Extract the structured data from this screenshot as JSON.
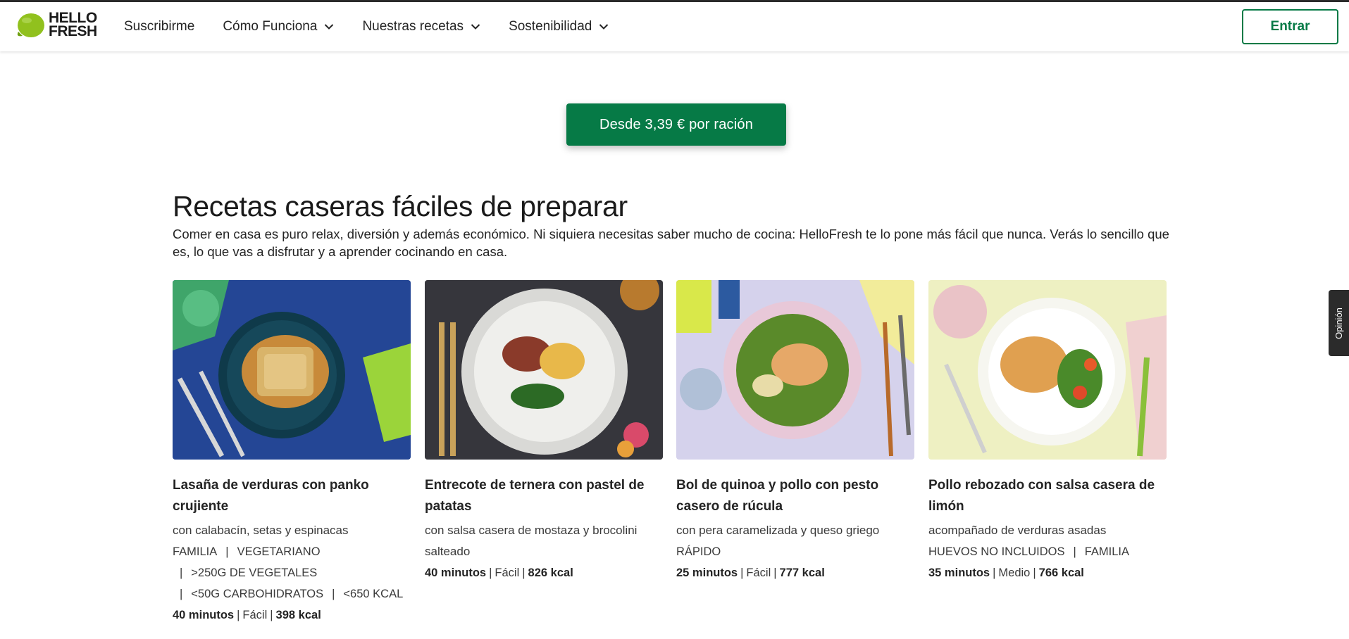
{
  "header": {
    "logo_line1": "HELLO",
    "logo_line2": "FRESH",
    "nav": [
      {
        "label": "Suscribirme",
        "has_dropdown": false
      },
      {
        "label": "Cómo Funciona",
        "has_dropdown": true
      },
      {
        "label": "Nuestras recetas",
        "has_dropdown": true
      },
      {
        "label": "Sostenibilidad",
        "has_dropdown": true
      }
    ],
    "login_label": "Entrar"
  },
  "cta_label": "Desde 3,39 € por ración",
  "section": {
    "title": "Recetas caseras fáciles de preparar",
    "description": "Comer en casa es puro relax, diversión y además económico. Ni siquiera necesitas saber mucho de cocina: HelloFresh te lo pone más fácil que nunca. Verás lo sencillo que es, lo que vas a disfrutar y a aprender cocinando en casa."
  },
  "recipes": [
    {
      "title": "Lasaña de verduras con panko crujiente",
      "subtitle": "con calabacín, setas y espinacas",
      "tags": [
        "FAMILIA",
        "VEGETARIANO",
        ">250G DE VEGETALES",
        "<50G CARBOHIDRATOS",
        "<650 KCAL"
      ],
      "time": "40 minutos",
      "difficulty": "Fácil",
      "kcal": "398 kcal"
    },
    {
      "title": "Entrecote de ternera con pastel de patatas",
      "subtitle": "con salsa casera de mostaza y brocolini salteado",
      "tags": [],
      "time": "40 minutos",
      "difficulty": "Fácil",
      "kcal": "826 kcal"
    },
    {
      "title": "Bol de quinoa y pollo con pesto casero de rúcula",
      "subtitle": "con pera caramelizada y queso griego",
      "tags": [
        "RÁPIDO"
      ],
      "time": "25 minutos",
      "difficulty": "Fácil",
      "kcal": "777 kcal"
    },
    {
      "title": "Pollo rebozado con salsa casera de limón",
      "subtitle": "acompañado de verduras asadas",
      "tags": [
        "HUEVOS NO INCLUIDOS",
        "FAMILIA"
      ],
      "time": "35 minutos",
      "difficulty": "Medio",
      "kcal": "766 kcal"
    }
  ],
  "feedback_label": "Opinión",
  "colors": {
    "brand_green": "#067a46",
    "logo_lime": "#91c11e",
    "text": "#242424"
  }
}
